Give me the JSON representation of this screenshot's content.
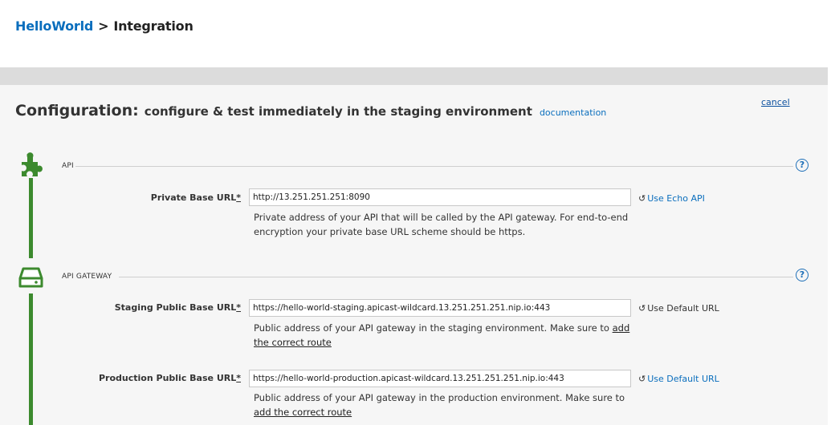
{
  "breadcrumb": {
    "parent": "HelloWorld",
    "separator": ">",
    "current": "Integration"
  },
  "config": {
    "title": "Configuration:",
    "subtitle": "configure & test immediately in the staging environment",
    "doc_link": "documentation",
    "cancel": "cancel"
  },
  "api_section": {
    "label": "API",
    "help": "?",
    "private_base_url": {
      "label": "Private Base URL",
      "required": "*",
      "value": "http://13.251.251.251:8090",
      "help": "Private address of your API that will be called by the API gateway. For end-to-end encryption your private base URL scheme should be https.",
      "action": "Use Echo API"
    }
  },
  "gateway_section": {
    "label": "API GATEWAY",
    "help": "?",
    "staging_url": {
      "label": "Staging Public Base URL",
      "required": "*",
      "value": "https://hello-world-staging.apicast-wildcard.13.251.251.251.nip.io:443",
      "help": "Public address of your API gateway in the staging environment. Make sure to",
      "help_link": "add the correct route",
      "action": "Use Default URL"
    },
    "production_url": {
      "label": "Production Public Base URL",
      "required": "*",
      "value": "https://hello-world-production.apicast-wildcard.13.251.251.251.nip.io:443",
      "help": "Public address of your API gateway in the production environment. Make sure to",
      "help_link": "add the correct route",
      "action": "Use Default URL"
    }
  },
  "icons": {
    "api": "puzzle-piece-icon",
    "gateway": "server-icon",
    "help": "question-circle-icon",
    "undo": "undo-icon"
  },
  "colors": {
    "accent_green": "#3c8a2e",
    "link_blue": "#0a6ebd"
  }
}
